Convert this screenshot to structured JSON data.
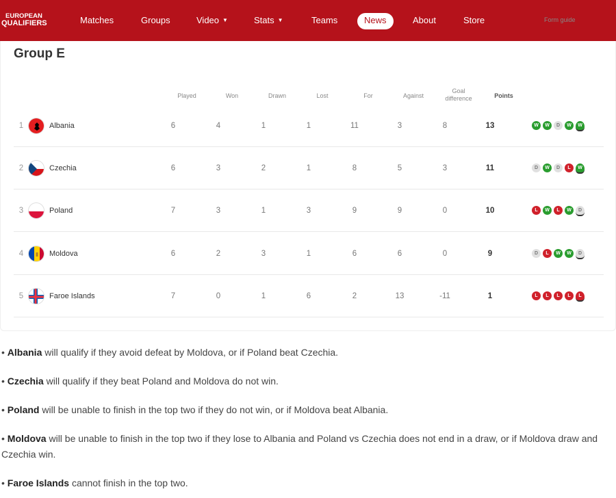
{
  "nav": {
    "logo_line1": "EUROPEAN",
    "logo_line2": "QUALIFIERS",
    "items": [
      {
        "label": "Matches",
        "dropdown": false,
        "active": false
      },
      {
        "label": "Groups",
        "dropdown": false,
        "active": false
      },
      {
        "label": "Video",
        "dropdown": true,
        "active": false
      },
      {
        "label": "Stats",
        "dropdown": true,
        "active": false
      },
      {
        "label": "Teams",
        "dropdown": false,
        "active": false
      },
      {
        "label": "News",
        "dropdown": false,
        "active": true
      },
      {
        "label": "About",
        "dropdown": false,
        "active": false
      },
      {
        "label": "Store",
        "dropdown": false,
        "active": false
      }
    ],
    "caret": "▼"
  },
  "group": {
    "title": "Group E",
    "headers": {
      "played": "Played",
      "won": "Won",
      "drawn": "Drawn",
      "lost": "Lost",
      "for": "For",
      "against": "Against",
      "goal_difference_1": "Goal",
      "goal_difference_2": "difference",
      "points": "Points",
      "form_guide": "Form guide"
    },
    "rows": [
      {
        "pos": "1",
        "team": "Albania",
        "flag": "albania",
        "played": "6",
        "won": "4",
        "drawn": "1",
        "lost": "1",
        "for": "11",
        "against": "3",
        "gd": "8",
        "points": "13",
        "form": [
          "W",
          "W",
          "D",
          "W",
          "W"
        ]
      },
      {
        "pos": "2",
        "team": "Czechia",
        "flag": "czechia",
        "played": "6",
        "won": "3",
        "drawn": "2",
        "lost": "1",
        "for": "8",
        "against": "5",
        "gd": "3",
        "points": "11",
        "form": [
          "D",
          "W",
          "D",
          "L",
          "W"
        ]
      },
      {
        "pos": "3",
        "team": "Poland",
        "flag": "poland",
        "played": "7",
        "won": "3",
        "drawn": "1",
        "lost": "3",
        "for": "9",
        "against": "9",
        "gd": "0",
        "points": "10",
        "form": [
          "L",
          "W",
          "L",
          "W",
          "D"
        ]
      },
      {
        "pos": "4",
        "team": "Moldova",
        "flag": "moldova",
        "played": "6",
        "won": "2",
        "drawn": "3",
        "lost": "1",
        "for": "6",
        "against": "6",
        "gd": "0",
        "points": "9",
        "form": [
          "D",
          "L",
          "W",
          "W",
          "D"
        ]
      },
      {
        "pos": "5",
        "team": "Faroe Islands",
        "flag": "faroe-islands",
        "played": "7",
        "won": "0",
        "drawn": "1",
        "lost": "6",
        "for": "2",
        "against": "13",
        "gd": "-11",
        "points": "1",
        "form": [
          "L",
          "L",
          "L",
          "L",
          "L"
        ]
      }
    ]
  },
  "notes": [
    {
      "team": "Albania",
      "text": " will qualify if they avoid defeat by Moldova, or if Poland beat Czechia."
    },
    {
      "team": "Czechia",
      "text": " will qualify if they beat Poland and Moldova do not win."
    },
    {
      "team": "Poland",
      "text": " will be unable to finish in the top two if they do not win, or if Moldova beat Albania."
    },
    {
      "team": "Moldova",
      "text": " will be unable to finish in the top two if they lose to Albania and Poland vs Czechia does not end in a draw, or if Moldova draw and Czechia win."
    },
    {
      "team": "Faroe Islands",
      "text": " cannot finish in the top two."
    }
  ],
  "bullet": "•",
  "colors": {
    "brand": "#b5121b",
    "win": "#2a9d2f",
    "draw": "#e0e0e0",
    "loss": "#d0212b"
  }
}
